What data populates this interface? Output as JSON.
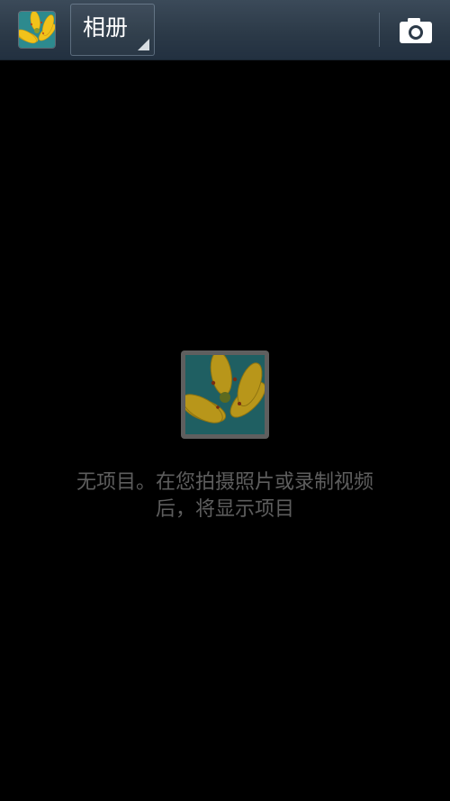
{
  "action_bar": {
    "app_icon": "flower-thumbnail-icon",
    "album_selector_label": "相册",
    "camera_icon": "camera-icon"
  },
  "empty_state": {
    "icon": "flower-thumbnail-icon",
    "message_line1": "无项目。在您拍摄照片或录制视频",
    "message_line2": "后，将显示项目"
  },
  "colors": {
    "action_bar_bg": "#2c3a48",
    "background": "#000000",
    "empty_text": "#5e5e5e"
  }
}
